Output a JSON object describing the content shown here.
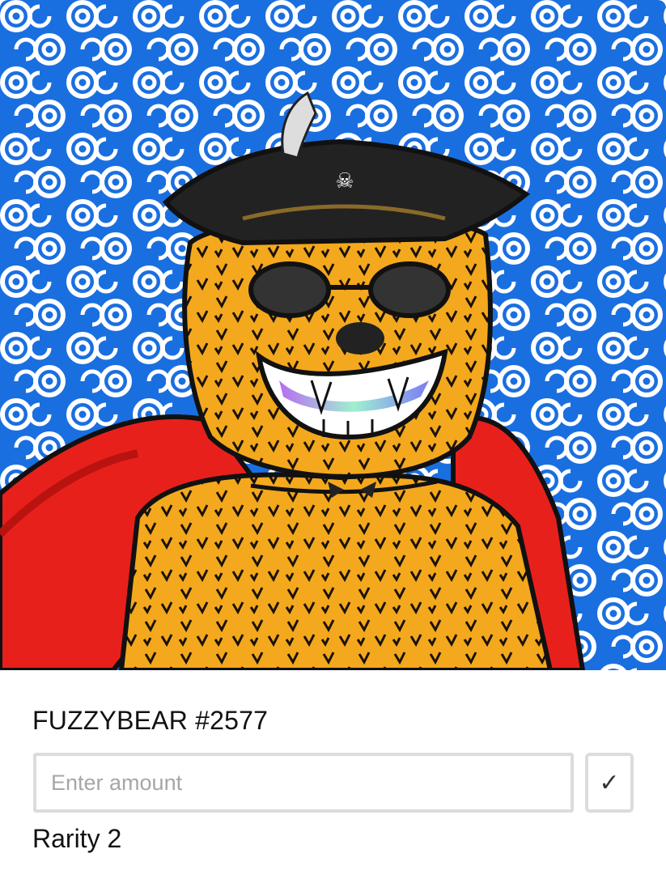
{
  "nft": {
    "title": "FUZZYBEAR #2577",
    "rarity": "Rarity 2",
    "image": "fuzzy-bear-pirate-art"
  },
  "amount_input": {
    "placeholder": "Enter amount",
    "value": ""
  },
  "confirm_button": {
    "icon": "checkmark-icon",
    "glyph": "✓"
  },
  "colors": {
    "background_blue": "#1a6fe0",
    "swirl": "#ffffff",
    "fur": "#f4a81d",
    "cape": "#e8201c",
    "hat": "#222222",
    "border": "#dcdcdc"
  }
}
